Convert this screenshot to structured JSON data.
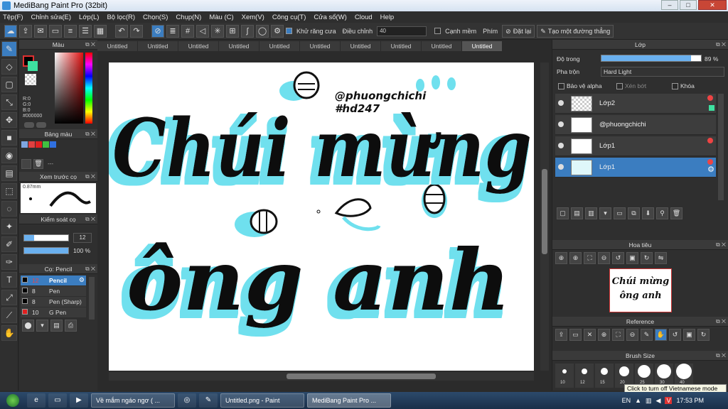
{
  "window": {
    "title": "MediBang Paint Pro (32bit)",
    "minimize": "–",
    "maximize": "□",
    "close": "✕"
  },
  "menu": [
    "Tệp(F)",
    "Chỉnh sửa(E)",
    "Lớp(L)",
    "Bộ lọc(R)",
    "Chọn(S)",
    "Chụp(N)",
    "Màu (C)",
    "Xem(V)",
    "Công cụ(T)",
    "Cửa sổ(W)",
    "Cloud",
    "Help"
  ],
  "toolbar": {
    "antialias_label": "Khử răng cưa",
    "adjust_label": "Điều chỉnh",
    "adjust_value": "40",
    "edge_label": "Cạnh mềm",
    "shortcut_label": "Phím",
    "reset_label": "Đặt lại",
    "straight_label": "Tạo một đường thẳng"
  },
  "tabs": [
    "Untitled",
    "Untitled",
    "Untitled",
    "Untitled",
    "Untitled",
    "Untitled",
    "Untitled",
    "Untitled",
    "Untitled",
    "Untitled"
  ],
  "left_panels": {
    "color_title": "Màu",
    "rgb_r": "R:0",
    "rgb_g": "G:0",
    "rgb_b": "B:0",
    "hex": "#000000",
    "palette_title": "Bảng màu",
    "palette_placeholder": "---",
    "preview_title": "Xem trước cọ",
    "preview_size": "0.87mm",
    "control_title": "Kiểm soát cọ",
    "brush_size": "12",
    "opacity": "100 %",
    "brush_title": "Cọ: Pencil",
    "brushes": [
      {
        "size": "12",
        "name": "Pencil",
        "selected": true
      },
      {
        "size": "8",
        "name": "Pen"
      },
      {
        "size": "8",
        "name": "Pen (Sharp)"
      },
      {
        "size": "10",
        "name": "G Pen"
      }
    ]
  },
  "canvas": {
    "signature": "@phuongchichi",
    "tag": "#hd247",
    "line1": "Chúi mừng",
    "line2": "ông anh"
  },
  "layer_panel": {
    "title": "Lớp",
    "opacity_label": "Độ trong",
    "opacity_value": "89 %",
    "blend_label": "Pha trộn",
    "blend_value": "Hard Light",
    "alpha_label": "Bảo vệ alpha",
    "clip_label": "Xén bớt",
    "lock_label": "Khóa",
    "layers": [
      {
        "name": "Lớp2"
      },
      {
        "name": "@phuongchichi"
      },
      {
        "name": "Lớp1"
      },
      {
        "name": "Lớp1",
        "selected": true
      }
    ]
  },
  "navigator_title": "Hoa tiêu",
  "reference_title": "Reference",
  "brush_size_title": "Brush Size",
  "brush_sizes": [
    "10",
    "12",
    "15",
    "20",
    "25",
    "30",
    "40"
  ],
  "tooltip": "Click to turn off Vietnamese mode",
  "taskbar": {
    "items": [
      "Về mắm ngáo ngơ ( ...",
      "Untitled.png - Paint",
      "MediBang Paint Pro ..."
    ],
    "lang": "EN",
    "time": "17:53 PM"
  },
  "colors": {
    "accent": "#3b7dc0",
    "ink": "#111111",
    "glow": "#6fe0ee"
  }
}
